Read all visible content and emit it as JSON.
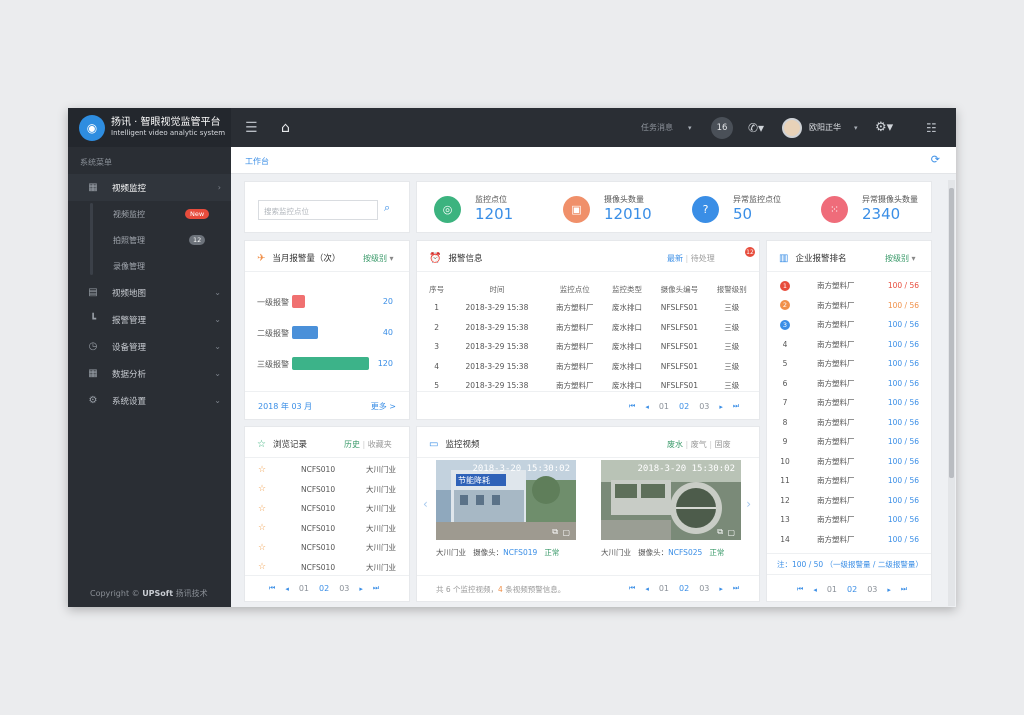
{
  "app": {
    "title": "扬讯 · 智眼视觉监管平台",
    "subtitle": "Intelligent video analytic system"
  },
  "sidebar": {
    "section_label": "系统菜单",
    "items": [
      {
        "label": "视频监控",
        "icon": "grid-icon",
        "active": true
      },
      {
        "label": "视频地图",
        "icon": "document-icon"
      },
      {
        "label": "报警管理",
        "icon": "chart-icon"
      },
      {
        "label": "设备管理",
        "icon": "clock-icon"
      },
      {
        "label": "数据分析",
        "icon": "table-icon"
      },
      {
        "label": "系统设置",
        "icon": "settings-icon"
      }
    ],
    "sub_items": [
      {
        "label": "视频监控",
        "badge": "New"
      },
      {
        "label": "拍照管理",
        "badge": "12"
      },
      {
        "label": "录像管理"
      }
    ],
    "copyright": {
      "prefix": "Copyright ©",
      "brand": "UPSoft",
      "company": "扬讯技术"
    }
  },
  "topbar": {
    "task_label": "任务消息",
    "task_count": "16",
    "user_name": "欧阳正华",
    "icons": [
      "menu-icon",
      "home-icon",
      "phone-icon",
      "gear-icon",
      "list-icon"
    ]
  },
  "breadcrumb": "工作台",
  "search": {
    "placeholder": "搜索监控点位"
  },
  "stats": [
    {
      "label": "监控点位",
      "value": "1201",
      "color": "#3cb37f",
      "icon": "location-icon"
    },
    {
      "label": "摄像头数量",
      "value": "12010",
      "color": "#f0906a",
      "icon": "camera-icon"
    },
    {
      "label": "异常监控点位",
      "value": "50",
      "color": "#3a8ee6",
      "icon": "question-icon"
    },
    {
      "label": "异常摄像头数量",
      "value": "2340",
      "color": "#ef6c7a",
      "icon": "dots-grid-icon"
    }
  ],
  "monthly_alarms": {
    "title": "当月报警量（次）",
    "filter": "按级别",
    "levels": [
      {
        "label": "一级报警",
        "value": "20",
        "color": "#f07070",
        "fill": 0.1667
      },
      {
        "label": "二级报警",
        "value": "40",
        "color": "#4a90d9",
        "fill": 0.3333
      },
      {
        "label": "三级报警",
        "value": "120",
        "color": "#3cb389",
        "fill": 1.0
      }
    ],
    "month": "2018 年 03 月",
    "more": "更多 >"
  },
  "alarm_info": {
    "title": "报警信息",
    "badge": "12",
    "tab_latest": "最新",
    "tab_pending": "待处理",
    "columns": [
      "序号",
      "时间",
      "监控点位",
      "监控类型",
      "摄像头编号",
      "报警级别"
    ],
    "rows": [
      [
        "1",
        "2018-3-29 15:38",
        "南方塑料厂",
        "废水排口",
        "NFSLFS01",
        "三级"
      ],
      [
        "2",
        "2018-3-29 15:38",
        "南方塑料厂",
        "废水排口",
        "NFSLFS01",
        "三级"
      ],
      [
        "3",
        "2018-3-29 15:38",
        "南方塑料厂",
        "废水排口",
        "NFSLFS01",
        "三级"
      ],
      [
        "4",
        "2018-3-29 15:38",
        "南方塑料厂",
        "废水排口",
        "NFSLFS01",
        "三级"
      ],
      [
        "5",
        "2018-3-29 15:38",
        "南方塑料厂",
        "废水排口",
        "NFSLFS01",
        "三级"
      ]
    ]
  },
  "ranking": {
    "title": "企业报警排名",
    "filter": "按级别",
    "rows": [
      {
        "no": "1",
        "name": "南方塑料厂",
        "value": "100 / 56",
        "color": "#e74c3c"
      },
      {
        "no": "2",
        "name": "南方塑料厂",
        "value": "100 / 56",
        "color": "#f0904a"
      },
      {
        "no": "3",
        "name": "南方塑料厂",
        "value": "100 / 56",
        "color": "#3a8ee6"
      },
      {
        "no": "4",
        "name": "南方塑料厂",
        "value": "100 / 56"
      },
      {
        "no": "5",
        "name": "南方塑料厂",
        "value": "100 / 56"
      },
      {
        "no": "6",
        "name": "南方塑料厂",
        "value": "100 / 56"
      },
      {
        "no": "7",
        "name": "南方塑料厂",
        "value": "100 / 56"
      },
      {
        "no": "8",
        "name": "南方塑料厂",
        "value": "100 / 56"
      },
      {
        "no": "9",
        "name": "南方塑料厂",
        "value": "100 / 56"
      },
      {
        "no": "10",
        "name": "南方塑料厂",
        "value": "100 / 56"
      },
      {
        "no": "11",
        "name": "南方塑料厂",
        "value": "100 / 56"
      },
      {
        "no": "12",
        "name": "南方塑料厂",
        "value": "100 / 56"
      },
      {
        "no": "13",
        "name": "南方塑料厂",
        "value": "100 / 56"
      },
      {
        "no": "14",
        "name": "南方塑料厂",
        "value": "100 / 56"
      }
    ],
    "note": "注：100 / 50 （一级报警量 / 二级报警量）"
  },
  "history": {
    "title": "浏览记录",
    "tab_history": "历史",
    "tab_favorites": "收藏夹",
    "rows": [
      {
        "code": "NCFS010",
        "loc": "大川门业"
      },
      {
        "code": "NCFS010",
        "loc": "大川门业"
      },
      {
        "code": "NCFS010",
        "loc": "大川门业"
      },
      {
        "code": "NCFS010",
        "loc": "大川门业"
      },
      {
        "code": "NCFS010",
        "loc": "大川门业"
      },
      {
        "code": "NCFS010",
        "loc": "大川门业"
      }
    ]
  },
  "video": {
    "title": "监控视频",
    "tab_water": "废水",
    "tab_gas": "废气",
    "tab_solid": "固废",
    "clips": [
      {
        "timestamp": "2018-3-20 15:30:02",
        "place": "大川门业",
        "camera_label": "摄像头：",
        "camera": "NCFS019",
        "status": "正常",
        "sign": "节能降耗"
      },
      {
        "timestamp": "2018-3-20 15:30:02",
        "place": "大川门业",
        "camera_label": "摄像头：",
        "camera": "NCFS025",
        "status": "正常"
      }
    ],
    "summary_prefix": "共 6 个监控视频，",
    "summary_count": "4",
    "summary_suffix": " 条视频预警信息。"
  },
  "pager": {
    "pages": [
      "01",
      "02",
      "03"
    ],
    "current": "02"
  }
}
